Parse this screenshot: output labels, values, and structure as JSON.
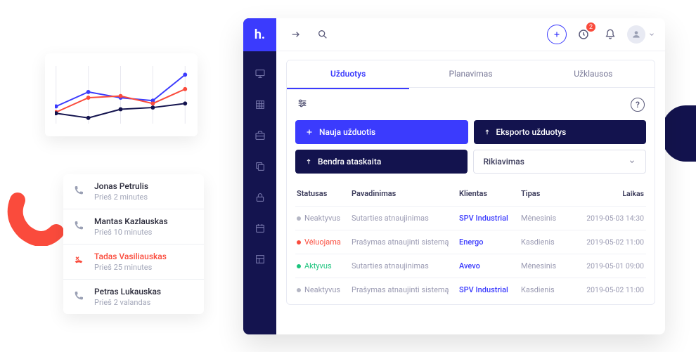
{
  "logo_text": "h.",
  "chart_data": {
    "type": "line",
    "x": [
      0,
      1,
      2,
      3,
      4
    ],
    "series": [
      {
        "name": "blue",
        "color": "#3b3bfd",
        "values": [
          30,
          55,
          45,
          40,
          85
        ]
      },
      {
        "name": "red",
        "color": "#fa4b3c",
        "values": [
          20,
          45,
          48,
          35,
          60
        ]
      },
      {
        "name": "navy",
        "color": "#13134e",
        "values": [
          18,
          10,
          25,
          28,
          35
        ]
      }
    ],
    "xlim": [
      0,
      4
    ],
    "ylim": [
      0,
      100
    ]
  },
  "calls": [
    {
      "name": "Jonas Petrulis",
      "time": "Prieš 2 minutes",
      "missed": false
    },
    {
      "name": "Mantas Kazlauskas",
      "time": "Prieš 10 minutes",
      "missed": false
    },
    {
      "name": "Tadas Vasiliauskas",
      "time": "Prieš 25 minutes",
      "missed": true
    },
    {
      "name": "Petras Lukauskas",
      "time": "Prieš 2 valandas",
      "missed": false
    }
  ],
  "notif_badge": "2",
  "tabs": [
    "Užduotys",
    "Planavimas",
    "Užklausos"
  ],
  "active_tab": 0,
  "buttons": {
    "new_task": "Nauja užduotis",
    "export": "Eksporto užduotys",
    "report": "Bendra ataskaita",
    "sort": "Rikiavimas"
  },
  "table": {
    "headers": [
      "Statusas",
      "Pavadinimas",
      "Klientas",
      "Tipas",
      "Laikas"
    ],
    "rows": [
      {
        "status": "Neaktyvus",
        "status_kind": "grey",
        "title": "Sutarties atnaujinimas",
        "client": "SPV Industrial",
        "type": "Mėnesinis",
        "time": "2019-05-03 14:30"
      },
      {
        "status": "Vėluojama",
        "status_kind": "red",
        "title": "Prašymas atnaujinti sistemą",
        "client": "Energo",
        "type": "Kasdienis",
        "time": "2019-05-02 11:00"
      },
      {
        "status": "Aktyvus",
        "status_kind": "green",
        "title": "Sutarties atnaujinimas",
        "client": "Avevo",
        "type": "Mėnesinis",
        "time": "2019-05-01 09:00"
      },
      {
        "status": "Neaktyvus",
        "status_kind": "grey",
        "title": "Prašymas atnaujinti sistemą",
        "client": "SPV Industrial",
        "type": "Kasdienis",
        "time": "2019-05-02 11:00"
      }
    ]
  }
}
